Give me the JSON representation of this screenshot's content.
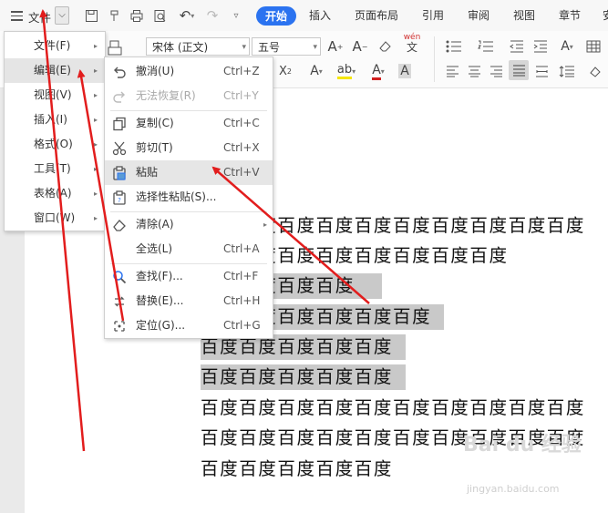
{
  "topbar": {
    "file_label": "文件",
    "tabs": [
      {
        "label": "开始",
        "active": true
      },
      {
        "label": "插入"
      },
      {
        "label": "页面布局"
      },
      {
        "label": "引用"
      },
      {
        "label": "审阅"
      },
      {
        "label": "视图"
      },
      {
        "label": "章节"
      },
      {
        "label": "安"
      }
    ]
  },
  "ribbon": {
    "font_name": "宋体 (正文)",
    "font_size": "五号",
    "phonetic_icon": "wén"
  },
  "main_menu": {
    "items": [
      {
        "label": "文件(F)"
      },
      {
        "label": "编辑(E)",
        "highlighted": true
      },
      {
        "label": "视图(V)"
      },
      {
        "label": "插入(I)"
      },
      {
        "label": "格式(O)"
      },
      {
        "label": "工具(T)"
      },
      {
        "label": "表格(A)"
      },
      {
        "label": "窗口(W)"
      }
    ]
  },
  "edit_menu": {
    "items": [
      {
        "label": "撤消(U)",
        "shortcut": "Ctrl+Z",
        "icon": "undo-icon"
      },
      {
        "label": "无法恢复(R)",
        "shortcut": "Ctrl+Y",
        "icon": "redo-icon",
        "disabled": true
      },
      {
        "label": "复制(C)",
        "shortcut": "Ctrl+C",
        "icon": "copy-icon"
      },
      {
        "label": "剪切(T)",
        "shortcut": "Ctrl+X",
        "icon": "cut-icon"
      },
      {
        "label": "粘贴",
        "shortcut": "Ctrl+V",
        "icon": "paste-icon",
        "highlighted": true
      },
      {
        "label": "选择性粘贴(S)...",
        "shortcut": "",
        "icon": "paste-special-icon"
      },
      {
        "label": "清除(A)",
        "shortcut": "",
        "icon": "eraser-icon",
        "submenu": true
      },
      {
        "label": "全选(L)",
        "shortcut": "Ctrl+A",
        "icon": ""
      },
      {
        "label": "查找(F)...",
        "shortcut": "Ctrl+F",
        "icon": "find-icon"
      },
      {
        "label": "替换(E)...",
        "shortcut": "Ctrl+H",
        "icon": "replace-icon"
      },
      {
        "label": "定位(G)...",
        "shortcut": "Ctrl+G",
        "icon": "goto-icon"
      }
    ]
  },
  "document": {
    "lines": [
      {
        "text": "百度百度百度百度百度百度百度百度百度百度",
        "selected": false
      },
      {
        "text": "百度百度百度百度百度百度百度百度",
        "selected": false
      },
      {
        "text": "百度百度百度百度",
        "selected": true
      },
      {
        "text": "百度百度百度百度百度百度",
        "selected": true
      },
      {
        "text": "百度百度百度百度百度",
        "selected": true
      },
      {
        "text": "百度百度百度百度百度",
        "selected": true
      },
      {
        "text": "百度百度百度百度百度百度百度百度百度百度",
        "selected": false
      },
      {
        "text": "百度百度百度百度百度百度百度百度百度百度",
        "selected": false
      },
      {
        "text": "百度百度百度百度百度",
        "selected": false
      }
    ]
  },
  "watermark": {
    "text": "Bai du 经验",
    "sub": "jingyan.baidu.com"
  },
  "colors": {
    "accent": "#2b73f0",
    "annotation": "#e21d1d",
    "selection": "#c9c9c9"
  }
}
